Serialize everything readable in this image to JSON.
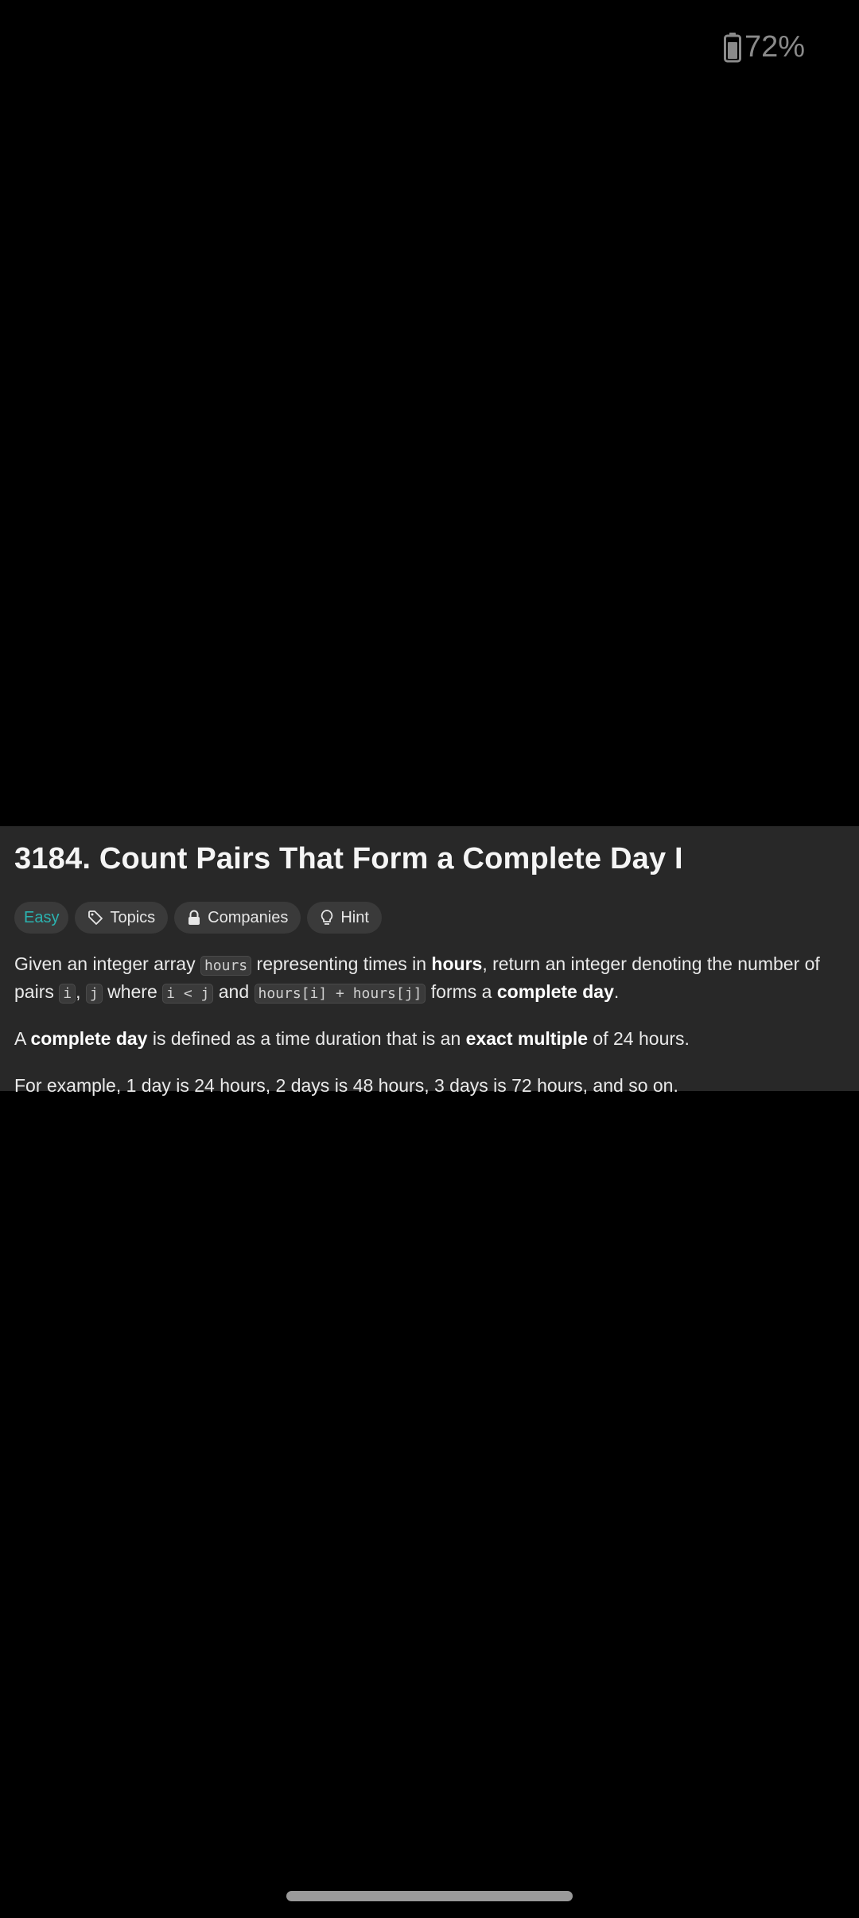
{
  "status_bar": {
    "battery_percent": "72%",
    "battery_icon": "battery-icon"
  },
  "problem": {
    "title": "3184. Count Pairs That Form a Complete Day I",
    "tags": {
      "difficulty": "Easy",
      "topics": "Topics",
      "companies": "Companies",
      "hint": "Hint"
    },
    "icons": {
      "topics": "tag-icon",
      "companies": "lock-icon",
      "hint": "lightbulb-icon"
    },
    "description": {
      "p1": {
        "t1": "Given an integer array ",
        "code_hours": "hours",
        "t2": " representing times in ",
        "b_hours": "hours",
        "t3": ", return an integer denoting the number of pairs ",
        "code_i": "i",
        "t4": ", ",
        "code_j": "j",
        "t5": " where ",
        "code_i_lt_j": "i < j",
        "t6": " and ",
        "code_sum": "hours[i] + hours[j]",
        "t7": " forms a ",
        "b_complete_day": "complete day",
        "t8": "."
      },
      "p2": {
        "t1": "A ",
        "b_complete_day": "complete day",
        "t2": " is defined as a time duration that is an ",
        "b_exact_multiple": "exact multiple",
        "t3": " of 24 hours."
      },
      "p3": {
        "t1": "For example, 1 day is 24 hours, 2 days is 48 hours, 3 days is 72 hours, and so on."
      }
    }
  },
  "colors": {
    "background": "#000000",
    "panel": "#282828",
    "tag_bg": "#3a3a3a",
    "easy": "#2bb3b0",
    "text": "#eaeaea"
  }
}
